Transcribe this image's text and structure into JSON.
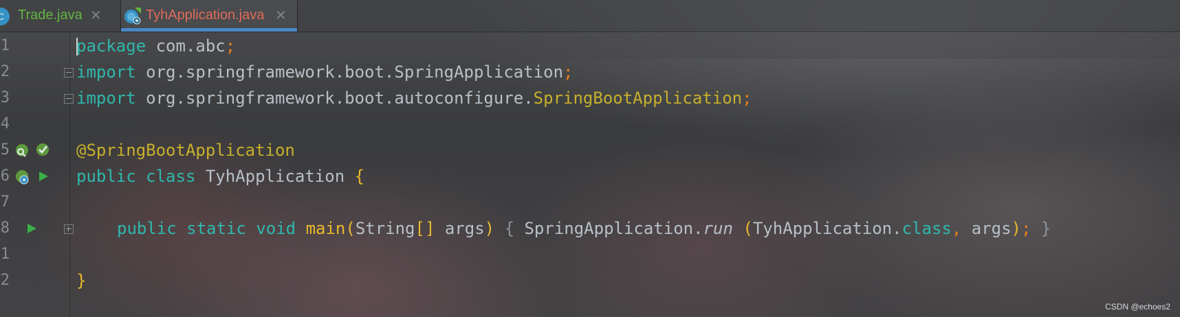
{
  "tabs": [
    {
      "label": "Trade.java",
      "icon": "java-class-icon",
      "icon_letter": "C",
      "color": "#62b543",
      "active": false,
      "close": "✕"
    },
    {
      "label": "TyhApplication.java",
      "icon": "spring-boot-app-icon",
      "color": "#e06c5a",
      "active": true,
      "close": "✕"
    }
  ],
  "editor": {
    "line_numbers": [
      "1",
      "2",
      "3",
      "4",
      "5",
      "6",
      "7",
      "8",
      "1",
      "2"
    ],
    "lines": [
      {
        "kw": "package",
        "rest": " com.abc",
        "semi": ";"
      },
      {
        "kw": "import",
        "rest": " org.springframework.boot.SpringApplication",
        "semi": ";"
      },
      {
        "kw": "import",
        "rest": " org.springframework.boot.autoconfigure.",
        "ref": "SpringBootApplication",
        "semi": ";"
      },
      {},
      {
        "annotation": "@SpringBootApplication"
      },
      {
        "kw1": "public",
        "kw2": "class",
        "name": " TyhApplication ",
        "brace": "{"
      },
      {},
      {
        "kw1": "public",
        "kw2": "static",
        "kw3": "void",
        "method": "main",
        "lp": "(",
        "type": "String",
        "brackets": "[]",
        "param": " args",
        "rp": ")",
        "fold_open": " { ",
        "call_obj": "SpringApplication.",
        "call_method": "run",
        "space": " ",
        "lp2": "(",
        "arg1": "TyhApplication.",
        "arg1_kw": "class",
        "comma": ",",
        "arg2": " args",
        "rp2": ")",
        "semi": ";",
        "fold_close": " }"
      },
      {},
      {
        "brace": "}"
      }
    ]
  },
  "watermark": "CSDN @echoes2",
  "colors": {
    "keyword": "#2fb8ac",
    "annotation": "#c7b02d",
    "semicolon": "#e8811a",
    "method": "#e8b92c",
    "active_tab_underline": "#4a88c7"
  }
}
